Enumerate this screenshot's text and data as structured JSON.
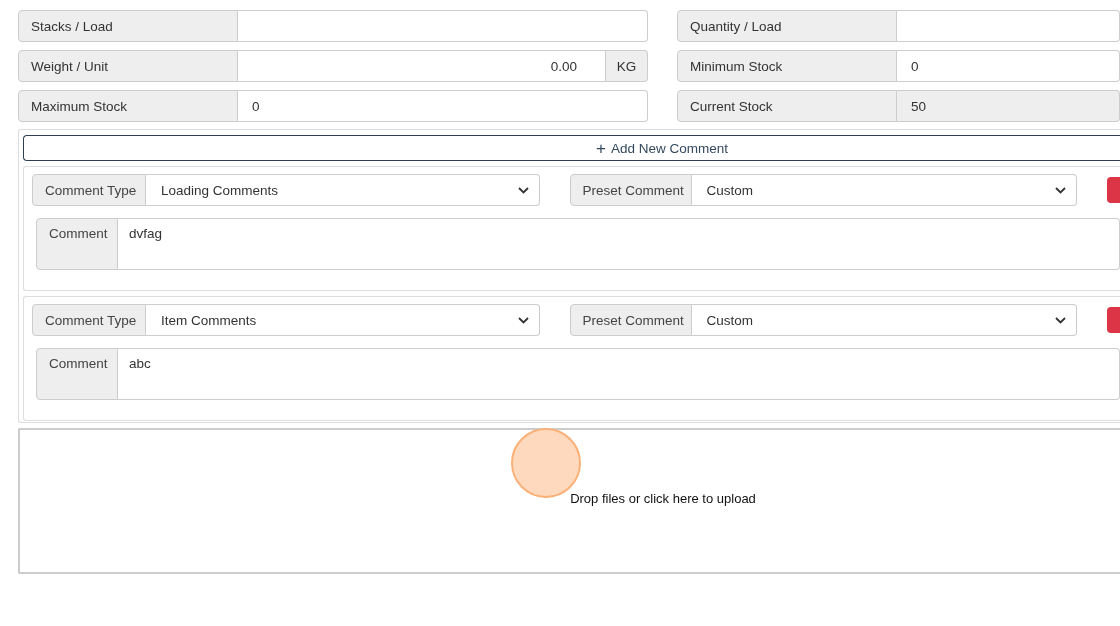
{
  "fields_left": [
    {
      "label": "Stacks / Load",
      "readonly": false
    },
    {
      "label": "Weight / Unit",
      "value": "0.00",
      "unit": "KG",
      "readonly": false
    },
    {
      "label": "Maximum Stock",
      "value": "0",
      "readonly": false
    }
  ],
  "fields_right": [
    {
      "label": "Quantity / Load",
      "readonly": false
    },
    {
      "label": "Minimum Stock",
      "value": "0",
      "readonly": false
    },
    {
      "label": "Current Stock",
      "value": "50",
      "readonly": true
    }
  ],
  "add_comment_button": {
    "icon": "+",
    "label": "Add New Comment"
  },
  "comments": [
    {
      "type_label": "Comment Type",
      "type_value": "Loading Comments",
      "preset_label": "Preset Comment",
      "preset_value": "Custom",
      "comment_label": "Comment",
      "comment_value": "dvfag"
    },
    {
      "type_label": "Comment Type",
      "type_value": "Item Comments",
      "preset_label": "Preset Comment",
      "preset_value": "Custom",
      "comment_label": "Comment",
      "comment_value": "abc"
    }
  ],
  "dropzone": {
    "text": "Drop files or click here to upload"
  }
}
